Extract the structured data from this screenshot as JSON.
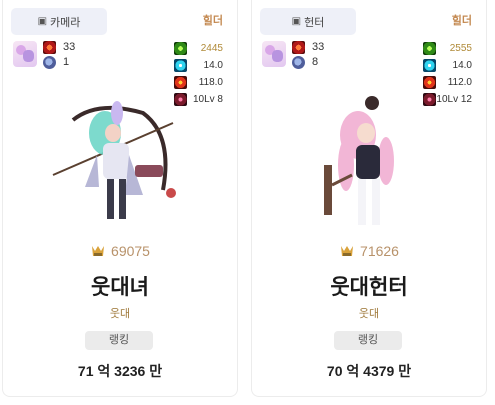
{
  "cards": [
    {
      "tag_icon": "character-icon",
      "tag_label": "카메라",
      "guild": "힐더",
      "level": "33",
      "count": "1",
      "stats": [
        "2445",
        "14.0",
        "118.0",
        "10Lv 8"
      ],
      "score": "69075",
      "name": "웃대녀",
      "adventure": "웃대",
      "rank_label": "랭킹",
      "fame_text": "71 억 3236 만"
    },
    {
      "tag_icon": "character-icon",
      "tag_label": "헌터",
      "guild": "힐더",
      "level": "33",
      "count": "8",
      "stats": [
        "2555",
        "14.0",
        "112.0",
        "10Lv 12"
      ],
      "score": "71626",
      "name": "웃대헌터",
      "adventure": "웃대",
      "rank_label": "랭킹",
      "fame_text": "70 억 4379 만"
    }
  ],
  "colors": {
    "score": "#b8926a",
    "guild": "#c48a52",
    "adventure": "#a07a3c"
  }
}
